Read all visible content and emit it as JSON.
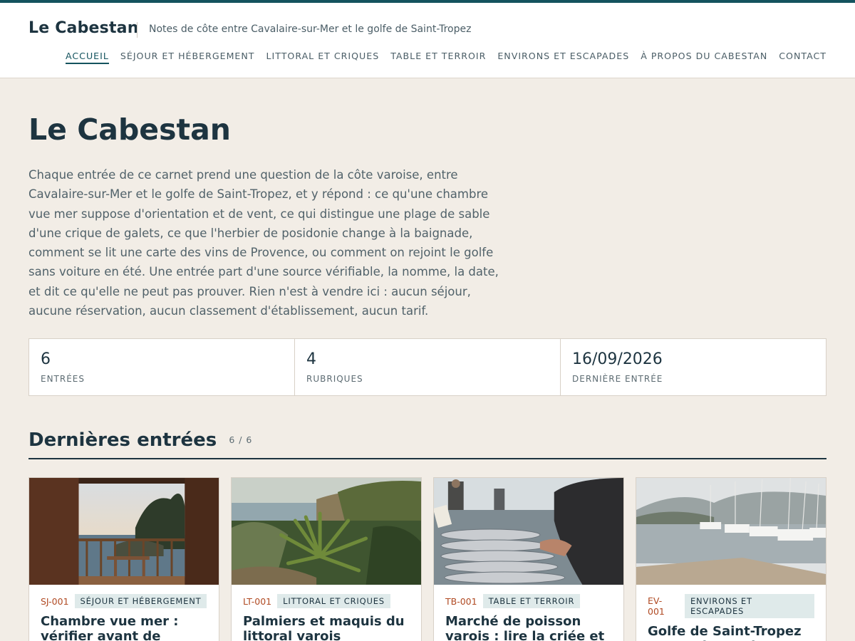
{
  "site": {
    "brand": "Le Cabestan",
    "tagline": "Notes de côte entre Cavalaire-sur-Mer et le golfe de Saint-Tropez"
  },
  "nav": [
    {
      "label": "ACCUEIL",
      "active": true
    },
    {
      "label": "SÉJOUR ET HÉBERGEMENT"
    },
    {
      "label": "LITTORAL ET CRIQUES"
    },
    {
      "label": "TABLE ET TERROIR"
    },
    {
      "label": "ENVIRONS ET ESCAPADES"
    },
    {
      "label": "À PROPOS DU CABESTAN"
    },
    {
      "label": "CONTACT"
    }
  ],
  "hero": {
    "title": "Le Cabestan",
    "intro": "Chaque entrée de ce carnet prend une question de la côte varoise, entre Cavalaire-sur-Mer et le golfe de Saint-Tropez, et y répond : ce qu'une chambre vue mer suppose d'orientation et de vent, ce qui distingue une plage de sable d'une crique de galets, ce que l'herbier de posidonie change à la baignade, comment se lit une carte des vins de Provence, ou comment on rejoint le golfe sans voiture en été. Une entrée part d'une source vérifiable, la nomme, la date, et dit ce qu'elle ne peut pas prouver. Rien n'est à vendre ici : aucun séjour, aucune réservation, aucun classement d'établissement, aucun tarif."
  },
  "stats": [
    {
      "value": "6",
      "label": "ENTRÉES"
    },
    {
      "value": "4",
      "label": "RUBRIQUES"
    },
    {
      "value": "16/09/2026",
      "label": "DERNIÈRE ENTRÉE"
    }
  ],
  "latest": {
    "title": "Dernières entrées",
    "count": "6 / 6"
  },
  "cards": [
    {
      "code": "SJ-001",
      "category": "SÉJOUR ET HÉBERGEMENT",
      "title": "Chambre vue mer : vérifier avant de réserver",
      "image": "balcony-sea-view-photo"
    },
    {
      "code": "LT-001",
      "category": "LITTORAL ET CRIQUES",
      "title": "Palmiers et maquis du littoral varois",
      "image": "palm-maquis-photo"
    },
    {
      "code": "TB-001",
      "category": "TABLE ET TERROIR",
      "title": "Marché de poisson varois : lire la criée et cuisiner",
      "image": "fish-market-photo"
    },
    {
      "code": "EV-001",
      "category": "ENVIRONS ET ESCAPADES",
      "title": "Golfe de Saint-Tropez sans voiture : bateau, bus,",
      "image": "marina-photo"
    }
  ],
  "colors": {
    "accent": "#14535e",
    "background": "#f2ede6",
    "code": "#b04a23",
    "tag_bg": "#dfeaea"
  }
}
